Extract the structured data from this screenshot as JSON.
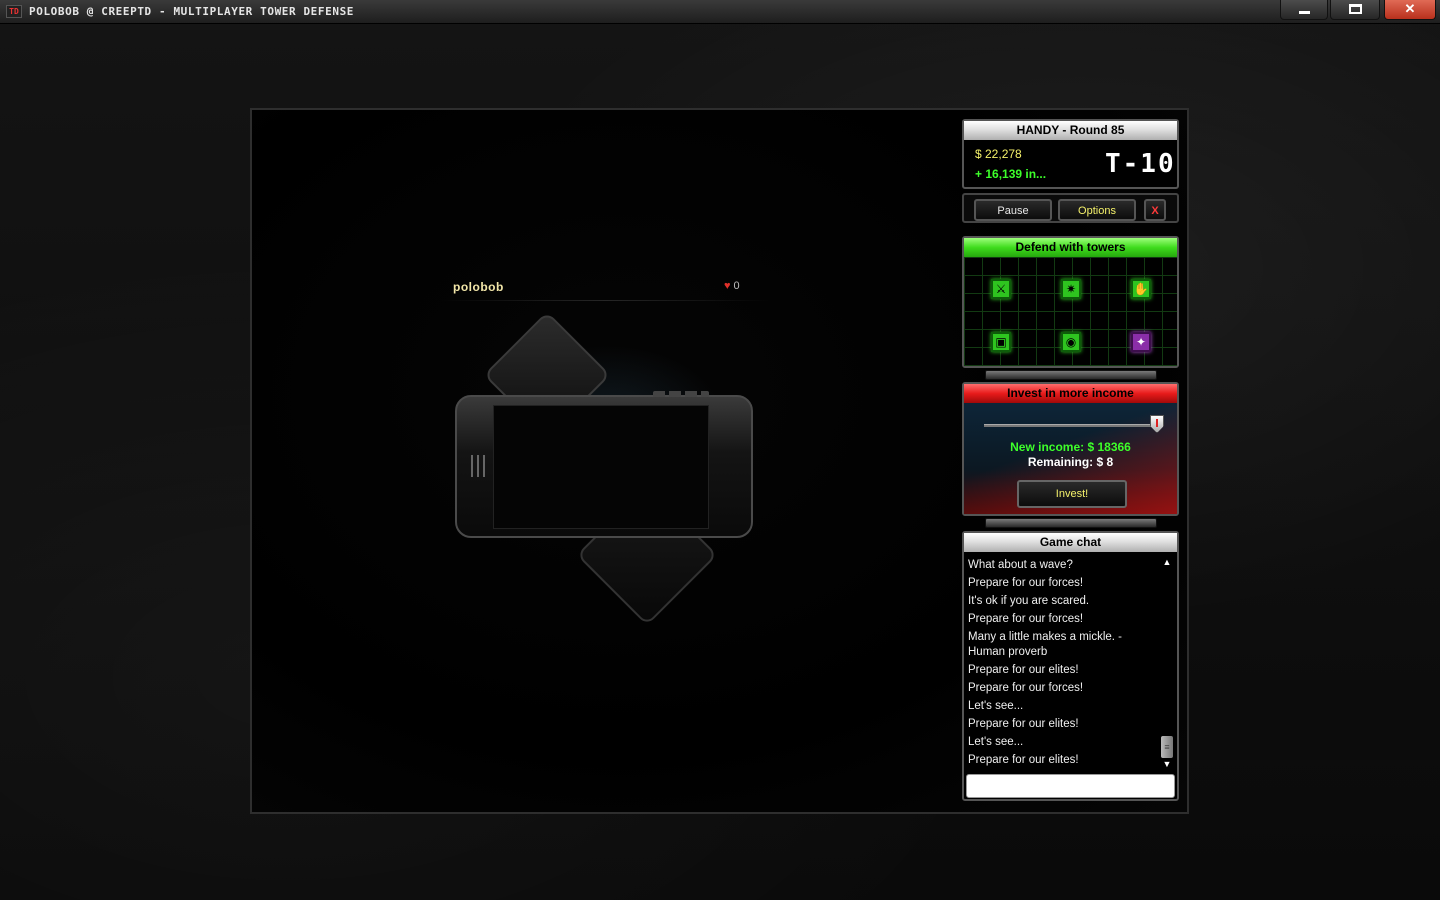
{
  "window": {
    "title": "polobob @ CreepTD - Multiplayer Tower Defense",
    "app_icon": "TD",
    "close_glyph": "✕"
  },
  "player": {
    "name": "polobob",
    "lives": "0",
    "heart_icon": "♥"
  },
  "status": {
    "header": "HANDY - Round 85",
    "money": "$ 22,278",
    "income": "+ 16,139 in...",
    "timer": "T-10"
  },
  "controls": {
    "pause_label": "Pause",
    "options_label": "Options",
    "close_label": "X"
  },
  "towers": {
    "header": "Defend with towers",
    "items": [
      {
        "icon": "⚔",
        "name": "tower-sword-icon",
        "color": "green"
      },
      {
        "icon": "✷",
        "name": "tower-burst-icon",
        "color": "green"
      },
      {
        "icon": "✋",
        "name": "tower-hand-icon",
        "color": "green"
      },
      {
        "icon": "▣",
        "name": "tower-square-icon",
        "color": "green"
      },
      {
        "icon": "◉",
        "name": "tower-target-icon",
        "color": "green"
      },
      {
        "icon": "✦",
        "name": "tower-star-icon",
        "color": "purple"
      }
    ]
  },
  "invest": {
    "header": "Invest in more income",
    "slider_level": 1.0,
    "new_income": "New income: $ 18366",
    "remaining": "Remaining: $ 8",
    "button_label": "Invest!"
  },
  "chat": {
    "header": "Game chat",
    "messages": [
      "What about a wave?",
      "Prepare for our forces!",
      "It's ok if you are scared.",
      "Prepare for our forces!",
      "Many a little makes a mickle. -Human proverb",
      "Prepare for our elites!",
      "Prepare for our forces!",
      "Let's see...",
      "Prepare for our elites!",
      "Let's see...",
      "Prepare for our elites!"
    ],
    "input_value": ""
  },
  "colors": {
    "money": "#f4f16a",
    "income": "#3dff2a",
    "green_header": "#3edc1d",
    "red_header": "#e81b1b"
  }
}
